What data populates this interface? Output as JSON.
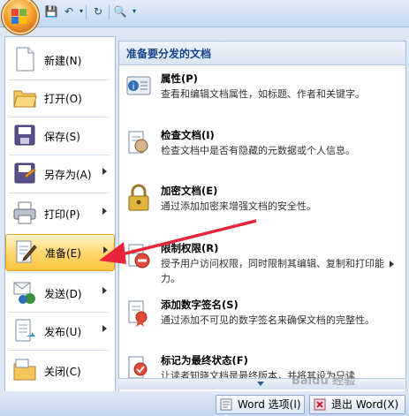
{
  "left_menu": {
    "items": [
      {
        "label": "新建(N)",
        "icon": "new-document-icon",
        "submenu": false
      },
      {
        "label": "打开(O)",
        "icon": "open-folder-icon",
        "submenu": false
      },
      {
        "label": "保存(S)",
        "icon": "save-disk-icon",
        "submenu": false
      },
      {
        "label": "另存为(A)",
        "icon": "save-as-icon",
        "submenu": true
      },
      {
        "label": "打印(P)",
        "icon": "print-icon",
        "submenu": true
      },
      {
        "label": "准备(E)",
        "icon": "prepare-icon",
        "submenu": true,
        "active": true
      },
      {
        "label": "发送(D)",
        "icon": "send-icon",
        "submenu": true
      },
      {
        "label": "发布(U)",
        "icon": "publish-icon",
        "submenu": true
      },
      {
        "label": "关闭(C)",
        "icon": "close-folder-icon",
        "submenu": false
      }
    ]
  },
  "right_panel": {
    "header": "准备要分发的文档",
    "items": [
      {
        "title": "属性(P)",
        "desc": "查看和编辑文档属性，如标题、作者和关键字。",
        "icon": "properties-icon"
      },
      {
        "title": "检查文档(I)",
        "desc": "检查文档中是否有隐藏的元数据或个人信息。",
        "icon": "inspect-document-icon"
      },
      {
        "title": "加密文档(E)",
        "desc": "通过添加加密来增强文档的安全性。",
        "icon": "encrypt-lock-icon"
      },
      {
        "title": "限制权限(R)",
        "desc": "授予用户访问权限，同时限制其编辑、复制和打印能力。",
        "icon": "restrict-permission-icon",
        "submenu": true
      },
      {
        "title": "添加数字签名(S)",
        "desc": "通过添加不可见的数字签名来确保文档的完整性。",
        "icon": "digital-signature-icon"
      },
      {
        "title": "标记为最终状态(F)",
        "desc": "让读者知晓文档是最终版本，并将其设为只读",
        "icon": "mark-final-icon"
      }
    ]
  },
  "bottom": {
    "options_label": "Word 选项(I)",
    "exit_label": "退出 Word(X)"
  },
  "watermark": "Baidu 经验",
  "colors": {
    "accent": "#15428b",
    "highlight": "#ffd66a",
    "arrow": "#e8253b"
  }
}
